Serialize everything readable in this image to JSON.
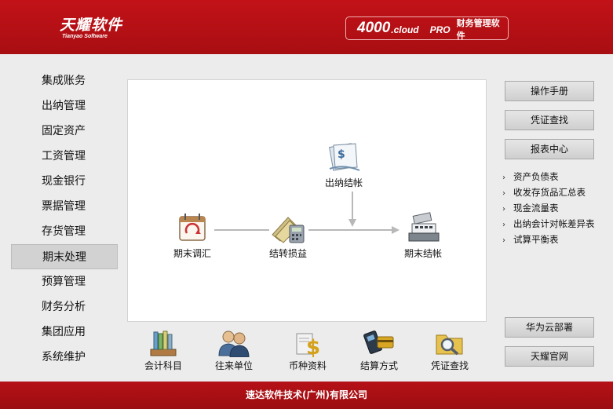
{
  "header": {
    "logo_zh": "天耀软件",
    "logo_en": "Tianyao Software",
    "product_number": "4000",
    "product_cloud": ".cloud",
    "product_pro": "PRO",
    "product_subtitle": "财务管理软件"
  },
  "sidebar": {
    "items": [
      {
        "label": "集成账务"
      },
      {
        "label": "出纳管理"
      },
      {
        "label": "固定资产"
      },
      {
        "label": "工资管理"
      },
      {
        "label": "现金银行"
      },
      {
        "label": "票据管理"
      },
      {
        "label": "存货管理"
      },
      {
        "label": "期末处理",
        "active": true
      },
      {
        "label": "预算管理"
      },
      {
        "label": "财务分析"
      },
      {
        "label": "集团应用"
      },
      {
        "label": "系统维护"
      }
    ]
  },
  "flow": {
    "cashier_close": "出纳结帐",
    "period_adjust": "期末调汇",
    "transfer_pl": "结转损益",
    "period_close": "期末结帐"
  },
  "toolbar": {
    "items": [
      {
        "label": "会计科目",
        "icon": "ledger-books-icon"
      },
      {
        "label": "往来单位",
        "icon": "people-icon"
      },
      {
        "label": "币种资料",
        "icon": "currency-icon"
      },
      {
        "label": "结算方式",
        "icon": "pos-terminal-icon"
      },
      {
        "label": "凭证查找",
        "icon": "folder-search-icon"
      }
    ]
  },
  "right": {
    "manual": "操作手册",
    "voucher_search": "凭证查找",
    "report_center": "报表中心",
    "reports": [
      "资产负债表",
      "收发存货品汇总表",
      "现金流量表",
      "出纳会计对帐差异表",
      "试算平衡表"
    ],
    "huawei": "华为云部署",
    "official": "天耀官网"
  },
  "footer": {
    "company": "速达软件技术(广州)有限公司"
  },
  "colors": {
    "brand_red": "#b31118",
    "panel_bg": "#ffffff",
    "page_bg": "#ececec"
  }
}
